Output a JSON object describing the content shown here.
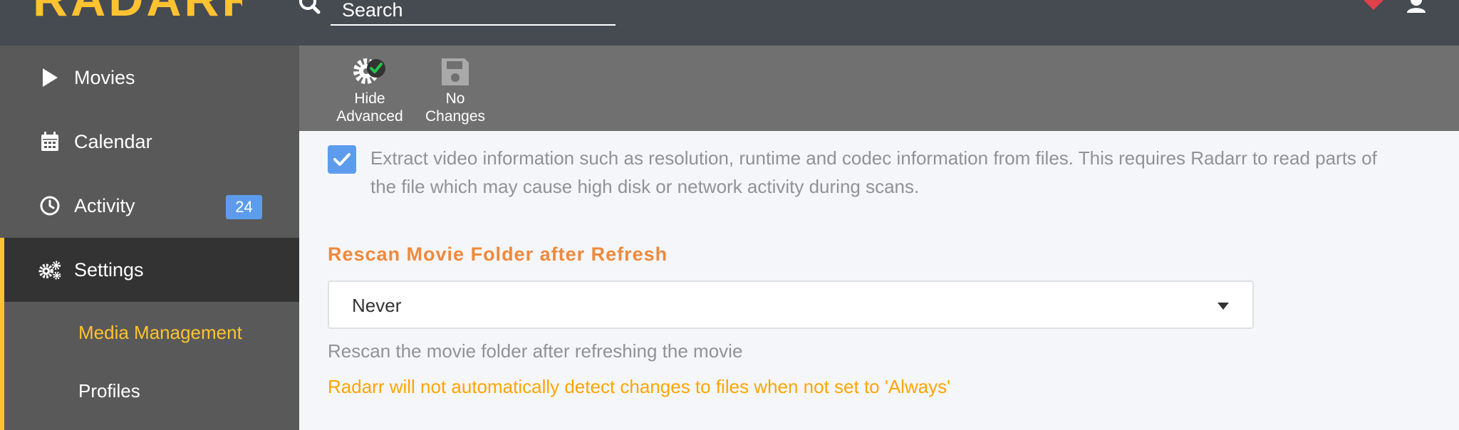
{
  "app": {
    "logo_text": "RADARR"
  },
  "header": {
    "search_placeholder": "Search"
  },
  "sidebar": {
    "items": [
      {
        "label": "Movies",
        "icon": "play-icon"
      },
      {
        "label": "Calendar",
        "icon": "calendar-icon"
      },
      {
        "label": "Activity",
        "icon": "clock-icon",
        "badge": "24"
      },
      {
        "label": "Settings",
        "icon": "gears-icon",
        "active": true
      }
    ],
    "sub_items": [
      {
        "label": "Media Management",
        "active": true
      },
      {
        "label": "Profiles"
      }
    ]
  },
  "toolbar": {
    "hide_advanced_label": "Hide\nAdvanced",
    "no_changes_label": "No\nChanges"
  },
  "content": {
    "checkbox_checked": true,
    "checkbox_help": "Extract video information such as resolution, runtime and codec information from files. This requires Radarr to read parts of the file which may cause high disk or network activity during scans.",
    "rescan_label": "Rescan Movie Folder after Refresh",
    "rescan_value": "Never",
    "rescan_help": "Rescan the movie folder after refreshing the movie",
    "rescan_warning": "Radarr will not automatically detect changes to files when not set to 'Always'"
  },
  "colors": {
    "header_bg": "#464b51",
    "sidebar_bg": "#595959",
    "accent": "#ffc230",
    "primary": "#5d9cec",
    "label_orange": "#f0893a",
    "warning": "#ffa500"
  }
}
